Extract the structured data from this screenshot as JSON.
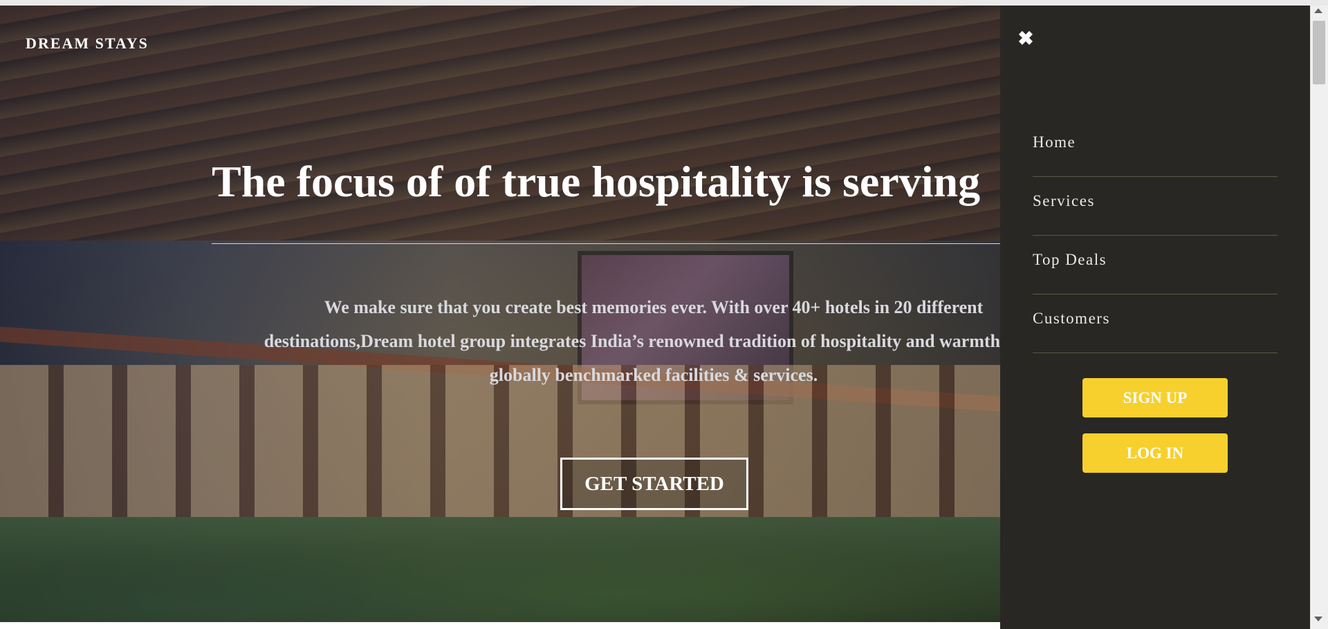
{
  "header": {
    "brand": "DREAM STAYS"
  },
  "hero": {
    "headline": "The focus of of true hospitality is serving",
    "description": "We make sure that you create best memories ever. With over 40+ hotels in 20 different destinations,Dream hotel group integrates India’s renowned tradition of hospitality and warmth, with globally benchmarked facilities & services.",
    "cta_label": "GET STARTED"
  },
  "menu": {
    "close_icon": "close-icon",
    "items": [
      {
        "label": "Home"
      },
      {
        "label": "Services"
      },
      {
        "label": "Top Deals"
      },
      {
        "label": "Customers"
      }
    ],
    "signup_label": "SIGN UP",
    "login_label": "LOG IN"
  },
  "colors": {
    "drawer_bg": "#292723",
    "accent_yellow": "#f7d02e",
    "divider": "#5a5a45"
  }
}
